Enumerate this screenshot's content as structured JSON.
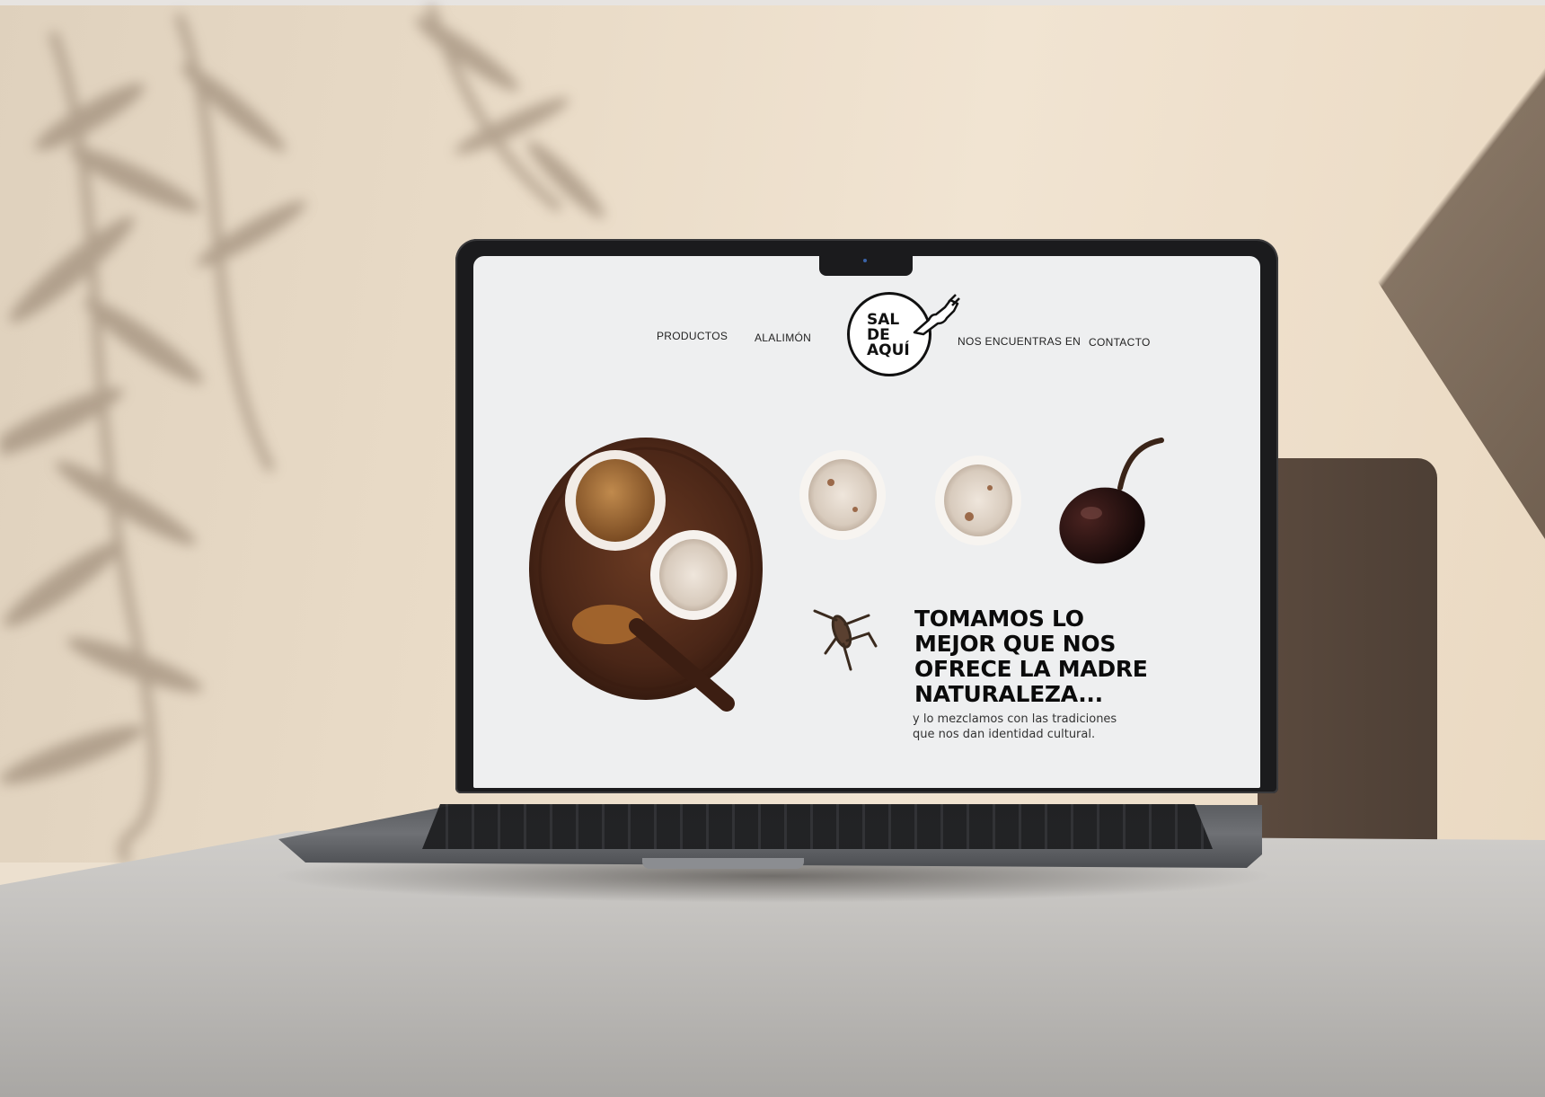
{
  "nav": {
    "left": [
      "PRODUCTOS",
      "ALALIMÓN"
    ],
    "right": [
      "NOS ENCUENTRAS EN",
      "CONTACTO"
    ]
  },
  "logo": {
    "text": "SAL\nDE\nAQUÍ",
    "icon": "hand-pointing-icon"
  },
  "hero": {
    "headline": "TOMAMOS LO\nMEJOR QUE NOS\nOFRECE LA MADRE\nNATURALEZA...",
    "subheadline": "y lo mezclamos con las tradiciones\nque nos dan identidad cultural."
  },
  "colors": {
    "text": "#0b0b0b",
    "page_bg": "#eeeff0",
    "wood": "#4a2617"
  }
}
